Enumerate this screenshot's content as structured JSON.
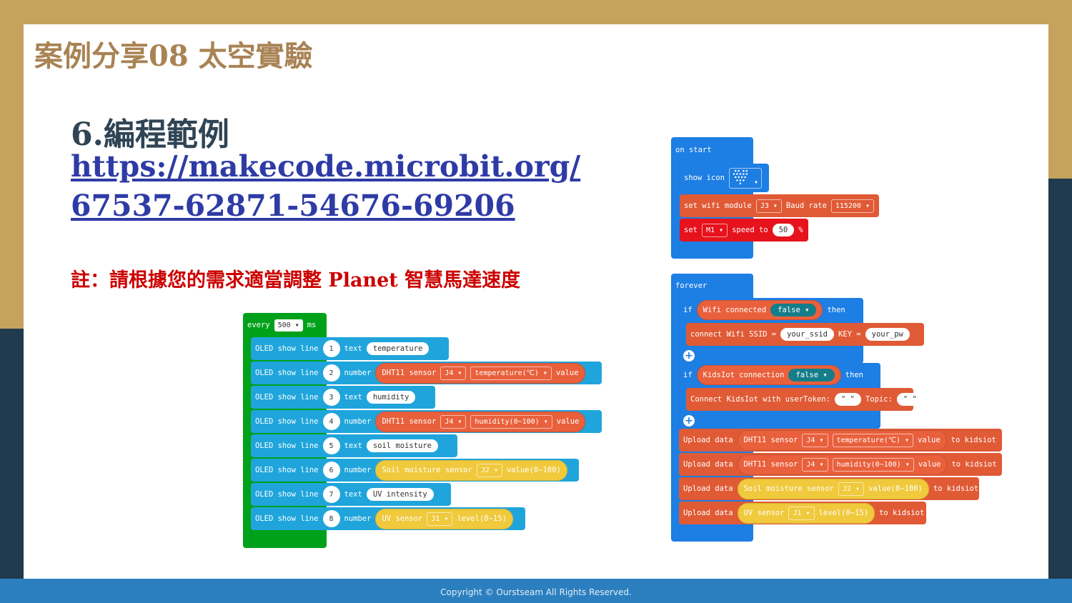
{
  "slide": {
    "title": "案例分享08 太空實驗",
    "heading": "6.編程範例",
    "link": "https://makecode.microbit.org/67537-62871-54676-69206",
    "note": "註：請根據您的需求適當調整 Planet 智慧馬達速度",
    "footer": "Copyright © Ourstseam All Rights Reserved."
  },
  "colors": {
    "oled": "#1fa5dc",
    "dht": "#e05a35",
    "soil": "#e8c033",
    "loop_green": "#00a11a",
    "basic_blue": "#1d7ee3",
    "motor_red": "#e6121c",
    "title_gold": "#a98354",
    "link_blue": "#2e3ba6",
    "note_red": "#cc0000"
  },
  "every_block": {
    "every": "every",
    "ms_value": "500",
    "ms": "ms",
    "oled_show_line": "OLED show line",
    "text_kw": "text",
    "number_kw": "number",
    "value_kw": "value",
    "lines": [
      {
        "n": "1",
        "kind": "text",
        "text": "temperature"
      },
      {
        "n": "2",
        "kind": "number",
        "sensor": "DHT11 sensor",
        "pin": "J4",
        "measure": "temperature(℃)"
      },
      {
        "n": "3",
        "kind": "text",
        "text": "humidity"
      },
      {
        "n": "4",
        "kind": "number",
        "sensor": "DHT11 sensor",
        "pin": "J4",
        "measure": "humidity(0~100)"
      },
      {
        "n": "5",
        "kind": "text",
        "text": "soil moisture"
      },
      {
        "n": "6",
        "kind": "number",
        "sensor": "Soil moisture sensor",
        "pin": "J2",
        "measure": "value(0~100)"
      },
      {
        "n": "7",
        "kind": "text",
        "text": "UV intensity"
      },
      {
        "n": "8",
        "kind": "number",
        "sensor": "UV sensor",
        "pin": "J1",
        "measure": "level(0~15)"
      }
    ]
  },
  "on_start": {
    "label": "on start",
    "show_icon": "show icon",
    "wifi_set": "set wifi module",
    "wifi_pin": "J3",
    "baud_label": "Baud rate",
    "baud_value": "115200",
    "set": "set",
    "motor": "M1",
    "speed_to": "speed to",
    "speed": "50",
    "percent": "%"
  },
  "forever": {
    "label": "forever",
    "if1_if": "if",
    "if1_cond": "Wifi connected",
    "if1_bool": "false",
    "if1_then": "then",
    "connect_label": "connect Wifi SSID =",
    "ssid": "your_ssid",
    "key_label": "KEY =",
    "pw": "your_pw",
    "if2_if": "if",
    "if2_cond": "KidsIot connection",
    "if2_bool": "false",
    "if2_then": "then",
    "connect2_label": "Connect KidsIot with userToken:",
    "token": "\" \"",
    "topic_label": "Topic:",
    "topic": "\" \"",
    "upload": "Upload data",
    "to_kidsiot": "to kidsiot",
    "uploads": [
      {
        "sensor": "DHT11 sensor",
        "pin": "J4",
        "measure": "temperature(℃)",
        "value": "value"
      },
      {
        "sensor": "DHT11 sensor",
        "pin": "J4",
        "measure": "humidity(0~100)",
        "value": "value"
      },
      {
        "sensor": "Soil moisture sensor",
        "pin": "J2",
        "measure": "value(0~100)",
        "value": ""
      },
      {
        "sensor": "UV sensor",
        "pin": "J1",
        "measure": "level(0~15)",
        "value": ""
      }
    ]
  }
}
